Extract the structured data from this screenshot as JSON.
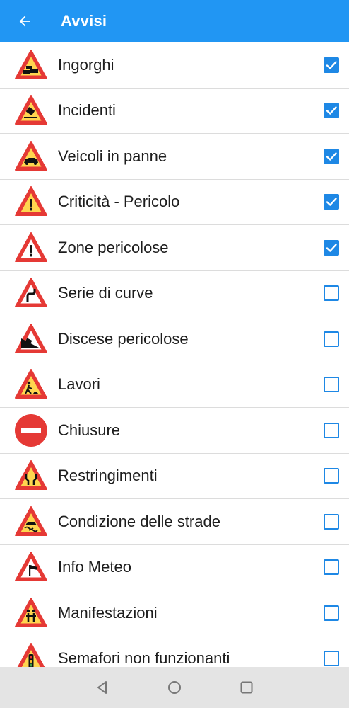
{
  "appbar": {
    "title": "Avvisi"
  },
  "colors": {
    "primary": "#2196f3",
    "checkbox": "#1e88e5",
    "sign_red": "#e53935",
    "sign_yellow": "#ffd54f"
  },
  "items": [
    {
      "label": "Ingorghi",
      "icon": "traffic-jam-sign-icon",
      "checked": true
    },
    {
      "label": "Incidenti",
      "icon": "accident-sign-icon",
      "checked": true
    },
    {
      "label": "Veicoli in panne",
      "icon": "broken-vehicle-sign-icon",
      "checked": true
    },
    {
      "label": "Criticità - Pericolo",
      "icon": "danger-sign-icon",
      "checked": true
    },
    {
      "label": "Zone pericolose",
      "icon": "dangerous-zone-sign-icon",
      "checked": true
    },
    {
      "label": "Serie di curve",
      "icon": "curves-sign-icon",
      "checked": false
    },
    {
      "label": "Discese pericolose",
      "icon": "steep-descent-sign-icon",
      "checked": false
    },
    {
      "label": "Lavori",
      "icon": "roadworks-sign-icon",
      "checked": false
    },
    {
      "label": "Chiusure",
      "icon": "no-entry-sign-icon",
      "checked": false
    },
    {
      "label": "Restringimenti",
      "icon": "road-narrows-sign-icon",
      "checked": false
    },
    {
      "label": "Condizione delle strade",
      "icon": "slippery-road-sign-icon",
      "checked": false
    },
    {
      "label": "Info Meteo",
      "icon": "crosswind-sign-icon",
      "checked": false
    },
    {
      "label": "Manifestazioni",
      "icon": "pedestrians-sign-icon",
      "checked": false
    },
    {
      "label": "Semafori non funzionanti",
      "icon": "traffic-light-sign-icon",
      "checked": false
    }
  ],
  "navbar": {
    "buttons": [
      "back-nav-icon",
      "home-nav-icon",
      "recents-nav-icon"
    ]
  }
}
